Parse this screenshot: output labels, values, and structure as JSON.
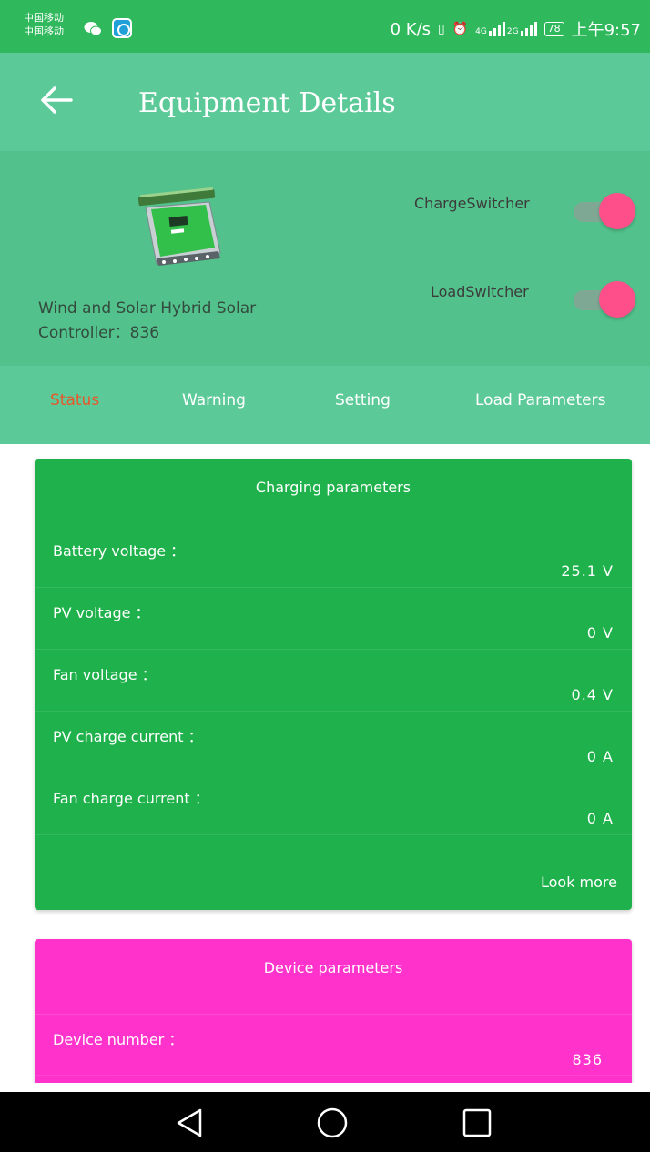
{
  "status_bar": {
    "carrier_1": "中国移动",
    "carrier_2": "中国移动",
    "speed": "0 K/s",
    "network_1": "4G",
    "network_2": "2G",
    "battery": "78",
    "time": "上午9:57",
    "icons": [
      "wechat-icon",
      "app-notification-icon",
      "vibrate-icon",
      "alarm-icon",
      "signal-icon",
      "battery-icon"
    ]
  },
  "app_bar": {
    "title": "Equipment Details",
    "back_icon": "arrow-left-icon"
  },
  "device": {
    "name": "Wind and Solar Hybrid Solar Controller：836",
    "image": "solar-controller-product-image",
    "charge_switch": {
      "label": "ChargeSwitcher",
      "on": true
    },
    "load_switch": {
      "label": "LoadSwitcher",
      "on": true
    }
  },
  "tabs": [
    {
      "label": "Status",
      "active": true
    },
    {
      "label": "Warning",
      "active": false
    },
    {
      "label": "Setting",
      "active": false
    },
    {
      "label": "Load Parameters",
      "active": false
    }
  ],
  "charging_card": {
    "title": "Charging parameters",
    "rows": [
      {
        "label": "Battery voltage ：",
        "value": "25.1 V"
      },
      {
        "label": "PV voltage ：",
        "value": "0 V"
      },
      {
        "label": "Fan voltage ：",
        "value": "0.4 V"
      },
      {
        "label": "PV charge current ：",
        "value": "0 A"
      },
      {
        "label": "Fan charge current ：",
        "value": "0 A"
      }
    ],
    "look_more": "Look more"
  },
  "device_card": {
    "title": "Device parameters",
    "rows": [
      {
        "label": "Device number ：",
        "value": "836"
      }
    ]
  },
  "nav_bar": {
    "buttons": [
      "back-triangle-icon",
      "home-circle-icon",
      "recents-square-icon"
    ]
  },
  "colors": {
    "status_bar": "#2fb85c",
    "app_bar": "#5cca98",
    "device_header": "#52c18b",
    "active_tab": "#e6582c",
    "charging_card": "#1fb14b",
    "device_card": "#ff33cc",
    "switch_thumb": "#ff4f8b"
  }
}
